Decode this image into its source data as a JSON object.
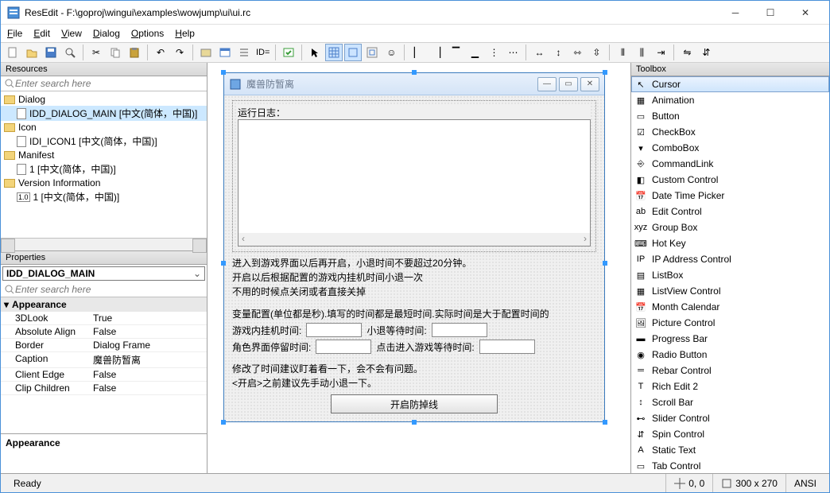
{
  "window": {
    "title": "ResEdit - F:\\goproj\\wingui\\examples\\wowjump\\ui\\ui.rc"
  },
  "menu": [
    "File",
    "Edit",
    "View",
    "Dialog",
    "Options",
    "Help"
  ],
  "toolbar": {
    "id_label": "ID="
  },
  "resources": {
    "title": "Resources",
    "search_placeholder": "Enter search here",
    "tree": {
      "dialog": "Dialog",
      "dialog_item": "IDD_DIALOG_MAIN [中文(简体，中国)]",
      "icon": "Icon",
      "icon_item": "IDI_ICON1 [中文(简体，中国)]",
      "manifest": "Manifest",
      "manifest_item": "1 [中文(简体，中国)]",
      "version": "Version Information",
      "version_item": "1 [中文(简体，中国)]"
    }
  },
  "properties": {
    "title": "Properties",
    "selected": "IDD_DIALOG_MAIN",
    "search_placeholder": "Enter search here",
    "category": "Appearance",
    "rows": [
      {
        "k": "3DLook",
        "v": "True"
      },
      {
        "k": "Absolute Align",
        "v": "False"
      },
      {
        "k": "Border",
        "v": "Dialog Frame"
      },
      {
        "k": "Caption",
        "v": "魔兽防暂离"
      },
      {
        "k": "Client Edge",
        "v": "False"
      },
      {
        "k": "Clip Children",
        "v": "False"
      }
    ],
    "desc": "Appearance"
  },
  "dialog": {
    "caption": "魔兽防暂离",
    "groupbox_label": "运行日志：",
    "text1": "进入到游戏界面以后再开启，小退时间不要超过20分钟。",
    "text2": "开启以后根据配置的游戏内挂机时间小退一次",
    "text3": "不用的时候点关闭或者直接关掉",
    "text4": "变量配置(单位都是秒).填写的时间都是最短时间.实际时间是大于配置时间的",
    "label1": "游戏内挂机时间:",
    "label2": "小退等待时间:",
    "label3": "角色界面停留时间:",
    "label4": "点击进入游戏等待时间:",
    "text5": "修改了时间建议盯着看一下，会不会有问题。",
    "text6": "<开启>之前建议先手动小退一下。",
    "button": "开启防掉线"
  },
  "toolbox": {
    "title": "Toolbox",
    "items": [
      "Cursor",
      "Animation",
      "Button",
      "CheckBox",
      "ComboBox",
      "CommandLink",
      "Custom Control",
      "Date Time Picker",
      "Edit Control",
      "Group Box",
      "Hot Key",
      "IP Address Control",
      "ListBox",
      "ListView Control",
      "Month Calendar",
      "Picture Control",
      "Progress Bar",
      "Radio Button",
      "Rebar Control",
      "Rich Edit 2",
      "Scroll Bar",
      "Slider Control",
      "Spin Control",
      "Static Text",
      "Tab Control"
    ]
  },
  "status": {
    "ready": "Ready",
    "pos": "0, 0",
    "size": "300 x 270",
    "enc": "ANSI"
  }
}
